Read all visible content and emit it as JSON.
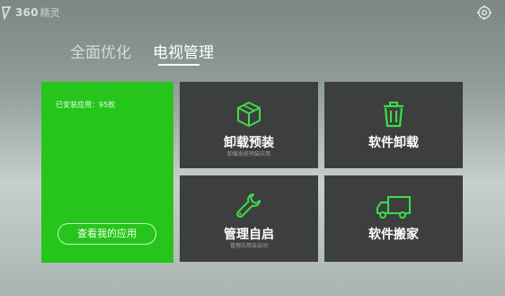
{
  "app": {
    "logo_text": "360",
    "logo_sub": "精灵"
  },
  "tabs": [
    {
      "label": "全面优化"
    },
    {
      "label": "电视管理"
    }
  ],
  "green_panel": {
    "installed_label": "已安装应用：95款",
    "button_label": "查看我的应用"
  },
  "tiles": [
    {
      "title": "卸载预装",
      "subtitle": "卸载系统预装应用",
      "icon": "box-icon"
    },
    {
      "title": "软件卸载",
      "subtitle": "",
      "icon": "trash-icon"
    },
    {
      "title": "管理自启",
      "subtitle": "管理应用自启动",
      "icon": "wrench-icon"
    },
    {
      "title": "软件搬家",
      "subtitle": "",
      "icon": "truck-icon"
    }
  ],
  "colors": {
    "accent_green": "#26c51c",
    "tile_bg": "#3d3f3e",
    "icon_green": "#3ddc4a"
  }
}
